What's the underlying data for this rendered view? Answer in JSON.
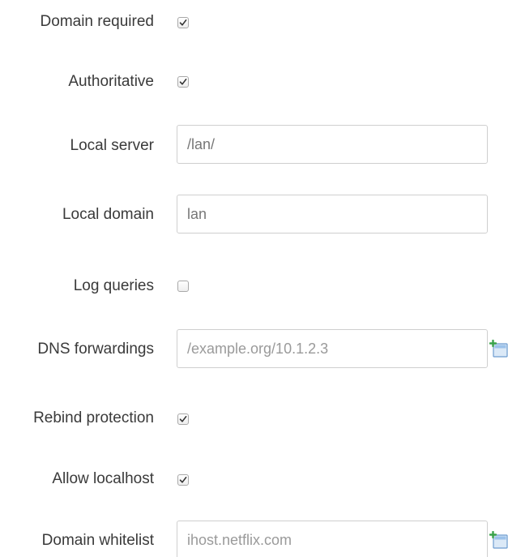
{
  "form": {
    "domain_required": {
      "label": "Domain required",
      "checked": true
    },
    "authoritative": {
      "label": "Authoritative",
      "checked": true
    },
    "local_server": {
      "label": "Local server",
      "value": "/lan/"
    },
    "local_domain": {
      "label": "Local domain",
      "value": "lan"
    },
    "log_queries": {
      "label": "Log queries",
      "checked": false
    },
    "dns_forwardings": {
      "label": "DNS forwardings",
      "placeholder": "/example.org/10.1.2.3"
    },
    "rebind_protection": {
      "label": "Rebind protection",
      "checked": true
    },
    "allow_localhost": {
      "label": "Allow localhost",
      "checked": true
    },
    "domain_whitelist": {
      "label": "Domain whitelist",
      "placeholder": "ihost.netflix.com"
    }
  },
  "icons": {
    "checkmark": "checkmark-icon",
    "add_row": "add-row-icon"
  },
  "colors": {
    "label_text": "#3a3a3a",
    "input_border": "#cfcfcf",
    "placeholder_text": "#9a9a9a",
    "icon_blue": "#5b9bd5",
    "icon_green": "#3aa34a"
  }
}
